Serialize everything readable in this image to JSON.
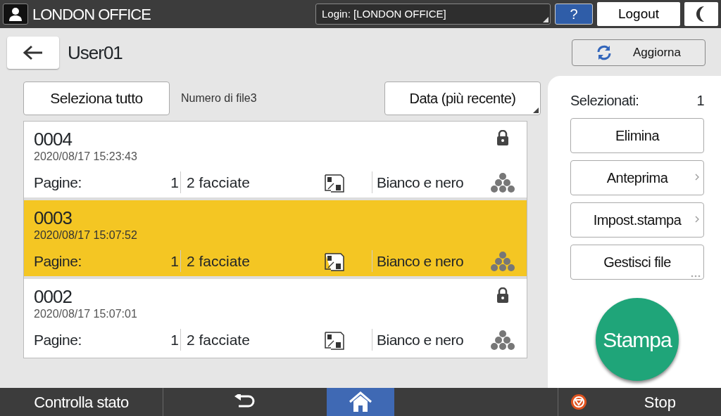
{
  "header": {
    "title": "LONDON OFFICE",
    "login": "Login: [LONDON OFFICE]",
    "help": "?",
    "logout": "Logout"
  },
  "toolbar": {
    "user": "User01",
    "refresh": "Aggiorna"
  },
  "list_controls": {
    "select_all": "Seleziona tutto",
    "file_count": "Numero di file3",
    "sort": "Data (più recente)"
  },
  "files": [
    {
      "name": "0004",
      "datetime": "2020/08/17 15:23:43",
      "pages_label": "Pagine:",
      "pages": "1",
      "duplex": "2 facciate",
      "color_mode": "Bianco e nero",
      "locked": true,
      "selected": false
    },
    {
      "name": "0003",
      "datetime": "2020/08/17 15:07:52",
      "pages_label": "Pagine:",
      "pages": "1",
      "duplex": "2 facciate",
      "color_mode": "Bianco e nero",
      "locked": false,
      "selected": true
    },
    {
      "name": "0002",
      "datetime": "2020/08/17 15:07:01",
      "pages_label": "Pagine:",
      "pages": "1",
      "duplex": "2 facciate",
      "color_mode": "Bianco e nero",
      "locked": true,
      "selected": false
    }
  ],
  "side_panel": {
    "selected_label": "Selezionati:",
    "selected_count": "1",
    "buttons": [
      {
        "label": "Elimina",
        "kind": "plain"
      },
      {
        "label": "Anteprima",
        "kind": "submenu"
      },
      {
        "label": "Impost.stampa",
        "kind": "submenu"
      },
      {
        "label": "Gestisci file",
        "kind": "more"
      }
    ],
    "print": "Stampa"
  },
  "status_bar": {
    "check_status": "Controlla stato",
    "stop": "Stop"
  }
}
